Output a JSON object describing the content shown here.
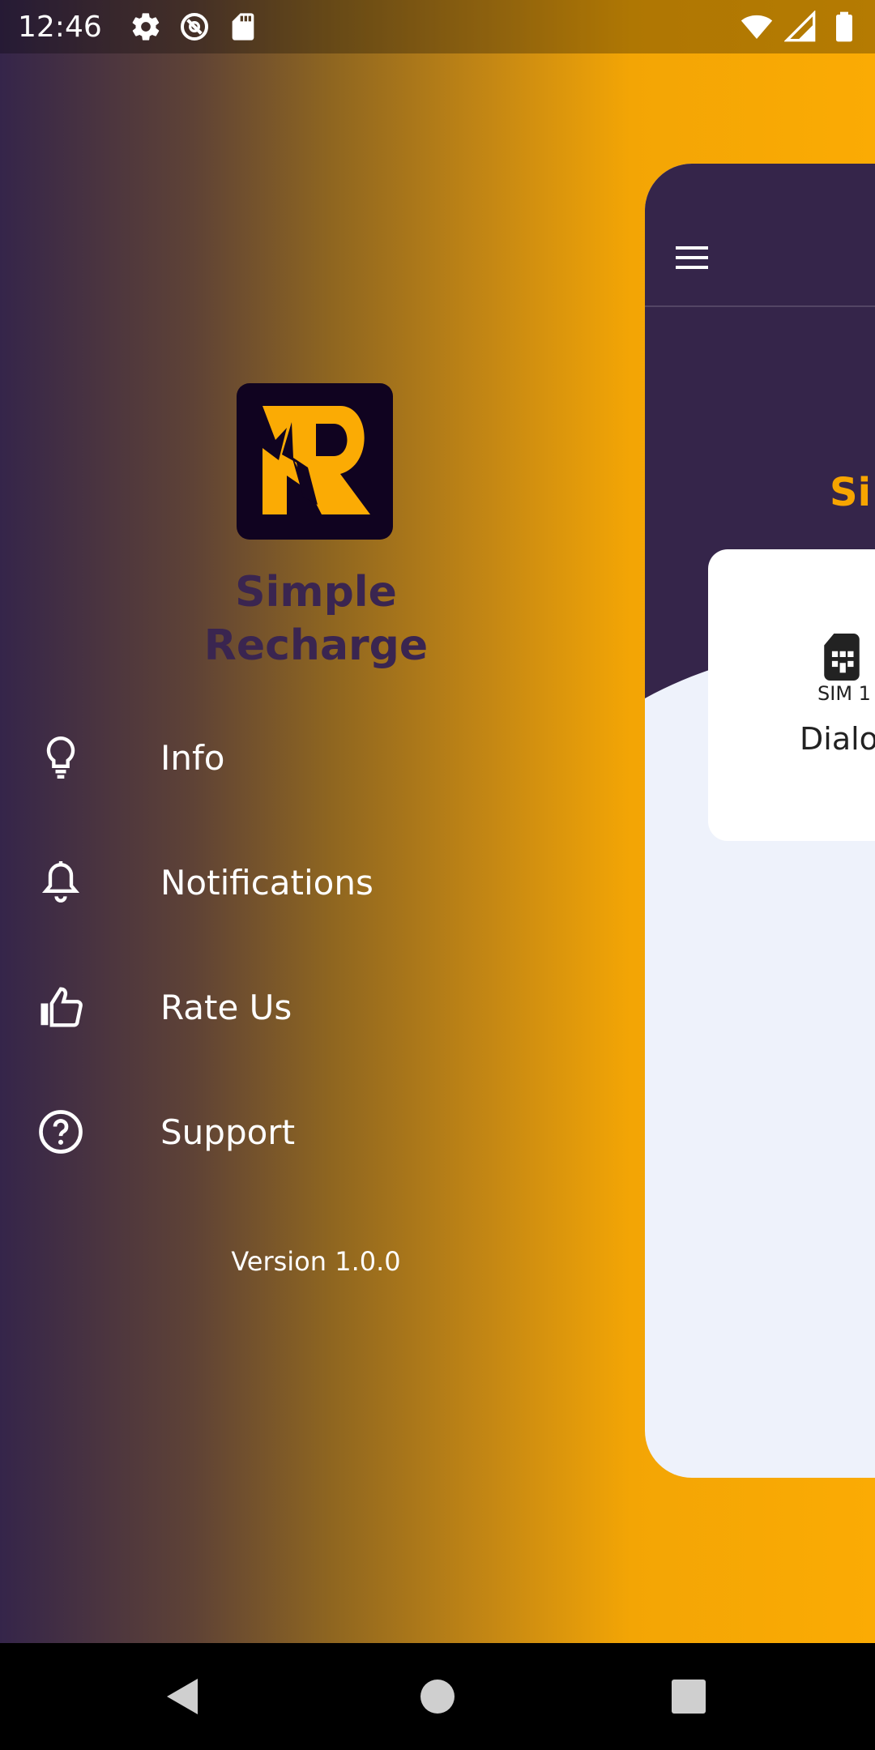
{
  "status_bar": {
    "time": "12:46",
    "left_icons": [
      "gear-icon",
      "do-not-disturb-icon",
      "sd-card-icon"
    ],
    "right_icons": [
      "wifi-icon",
      "cell-signal-icon",
      "battery-icon"
    ]
  },
  "drawer": {
    "app_name_line1": "Simple",
    "app_name_line2": "Recharge",
    "items": [
      {
        "label": "Info",
        "icon": "lightbulb-icon"
      },
      {
        "label": "Notifications",
        "icon": "bell-icon"
      },
      {
        "label": "Rate Us",
        "icon": "thumbs-up-icon"
      },
      {
        "label": "Support",
        "icon": "help-circle-icon"
      }
    ],
    "version": "Version 1.0.0"
  },
  "main": {
    "title_fragment": "Si",
    "sim_label": "SIM 1",
    "operator_fragment": "Dialo"
  },
  "nav_bar": {
    "buttons": [
      "back-icon",
      "home-icon",
      "recents-icon"
    ]
  },
  "colors": {
    "accent": "#f7a500",
    "dark_purple": "#35254a",
    "logo_bg": "#100320",
    "main_bg": "#eef2fb"
  }
}
